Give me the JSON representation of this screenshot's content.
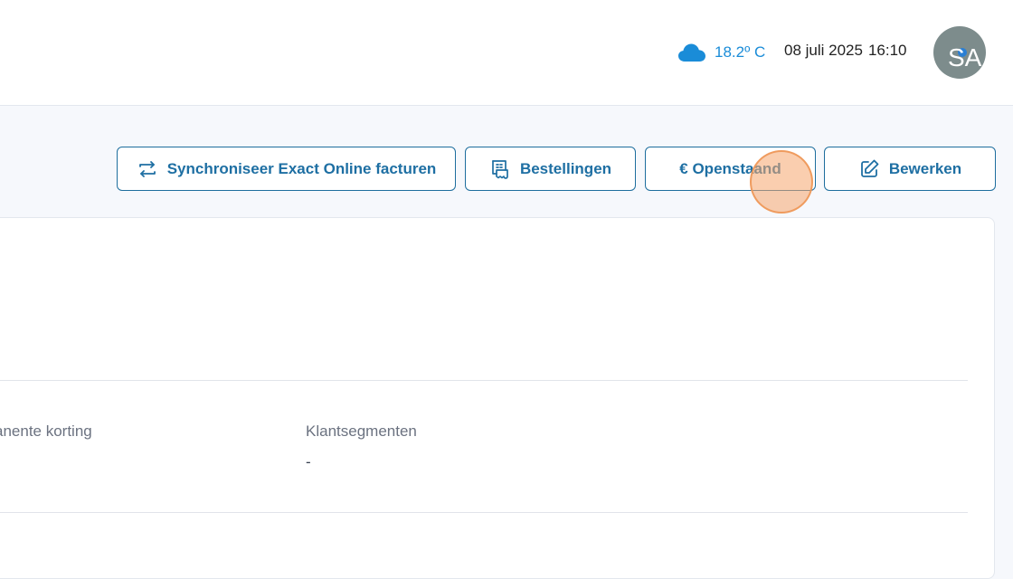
{
  "header": {
    "weather": {
      "icon": "cloud-icon",
      "temperature": "18.2º C",
      "color": "#1a8cd8"
    },
    "date": "08 juli 2025",
    "time": "16:10",
    "avatar": {
      "initials": "SA",
      "background": "#7d8c8c"
    }
  },
  "toolbar": {
    "sync_label": "Synchroniseer Exact Online facturen",
    "orders_label": "Bestellingen",
    "outstanding_label": "€ Openstaand",
    "edit_label": "Bewerken",
    "accent": "#1e6fa3"
  },
  "details": {
    "permanent_discount_label": "anente korting",
    "segments_label": "Klantsegmenten",
    "segments_value": "-"
  }
}
